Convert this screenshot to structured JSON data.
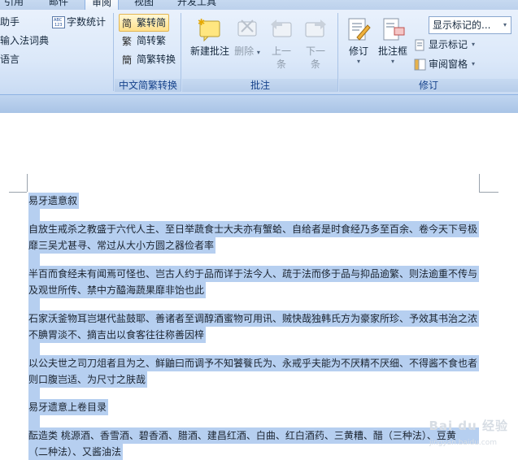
{
  "tabs": [
    {
      "label": "引用",
      "active": false
    },
    {
      "label": "邮件",
      "active": false
    },
    {
      "label": "审阅",
      "active": true
    },
    {
      "label": "视图",
      "active": false
    },
    {
      "label": "开发工具",
      "active": false
    }
  ],
  "proofing": {
    "items": [
      "助手",
      "输入法词典",
      "语言"
    ],
    "word_count": "字数统计"
  },
  "chinese_conversion": {
    "trad_to_simp": "繁转简",
    "simp_to_trad": "简转繁",
    "convert": "简繁转换",
    "group_label": "中文简繁转换"
  },
  "comments": {
    "new": "新建批注",
    "delete": "删除",
    "prev_top": "上一",
    "prev_bottom": "条",
    "next_top": "下一",
    "next_bottom": "条",
    "group_label": "批注"
  },
  "tracking": {
    "track_changes": "修订",
    "balloons": "批注框",
    "display_for_review": "显示标记的...",
    "show_markup": "显示标记",
    "reviewing_pane": "审阅窗格",
    "group_label": "修订"
  },
  "document": {
    "paragraphs": [
      [
        "易牙遗意叙"
      ],
      [
        "自放生戒杀之教盛于六代人主、至日举蔬食士大夫亦有蟹蛤、自给者是时食经乃多至百余、卷今天下号极",
        "靡三吴尤甚寻、常过从大小方圆之器俭者率"
      ],
      [
        "半百而食经未有闻焉可怪也、岂古人约于品而详于法今人、疏于法而侈于品与抑品逾繁、则法逾重不传与",
        "及观世所传、禁中方醯海蔬果靡非饴也此"
      ],
      [
        "石家沃釜物耳岂堪代盐鼓耶、善诸者至调醇酒蜜物可用讯、贼快哉独韩氏方为豪家所珍、予效其书治之浓",
        "不腆胃淡不、摘吉出以食客往往称善因梓"
      ],
      [
        "以公夫世之司刀俎者且为之、鲜鼬曰而调予不知饕餮氏为、永戒乎夫能为不厌精不厌细、不得酱不食也者",
        "则口腹岂适、为尺寸之肤哉"
      ],
      [
        "易牙遗意上卷目录"
      ],
      [
        "酝造类 桃源酒、香雪酒、碧香酒、腊酒、建昌红酒、白曲、红白酒药、三黄糟、醋（三种法）、豆黄",
        "（二种法）、又酱油法"
      ]
    ]
  },
  "watermark": {
    "logo": "Bai du 经验",
    "url": "jingyan.baidu.com"
  }
}
